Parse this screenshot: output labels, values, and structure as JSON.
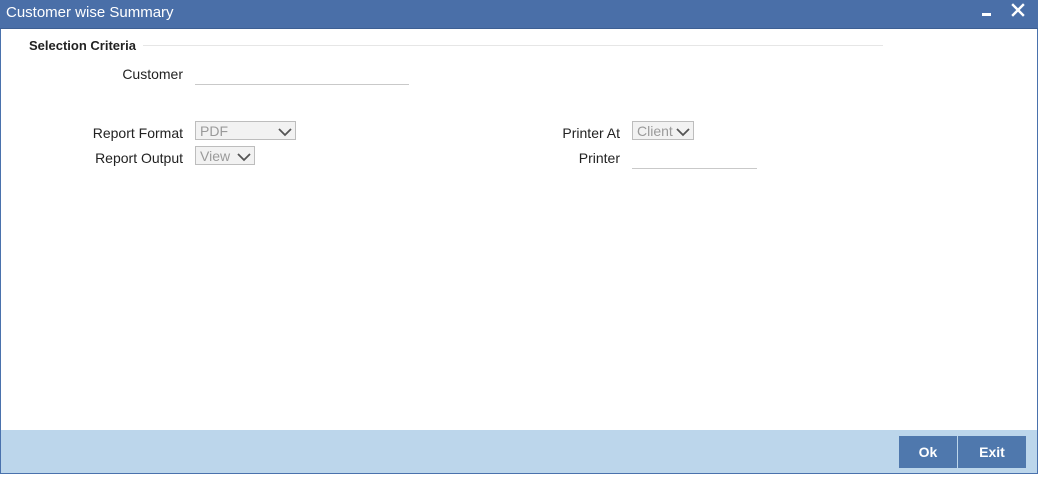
{
  "window": {
    "title": "Customer wise Summary"
  },
  "selection": {
    "section_title": "Selection Criteria",
    "customer_label": "Customer",
    "customer_value": ""
  },
  "report": {
    "format_label": "Report Format",
    "format_value": "PDF",
    "output_label": "Report Output",
    "output_value": "View",
    "printer_at_label": "Printer At",
    "printer_at_value": "Client",
    "printer_label": "Printer",
    "printer_value": ""
  },
  "footer": {
    "ok_label": "Ok",
    "exit_label": "Exit"
  },
  "icons": {
    "minimize": "minimize-icon",
    "close": "close-icon",
    "dropdown": "chevron-down-icon"
  },
  "colors": {
    "titlebar": "#4a6fa8",
    "footer": "#bcd6eb",
    "button": "#4f78ad"
  }
}
